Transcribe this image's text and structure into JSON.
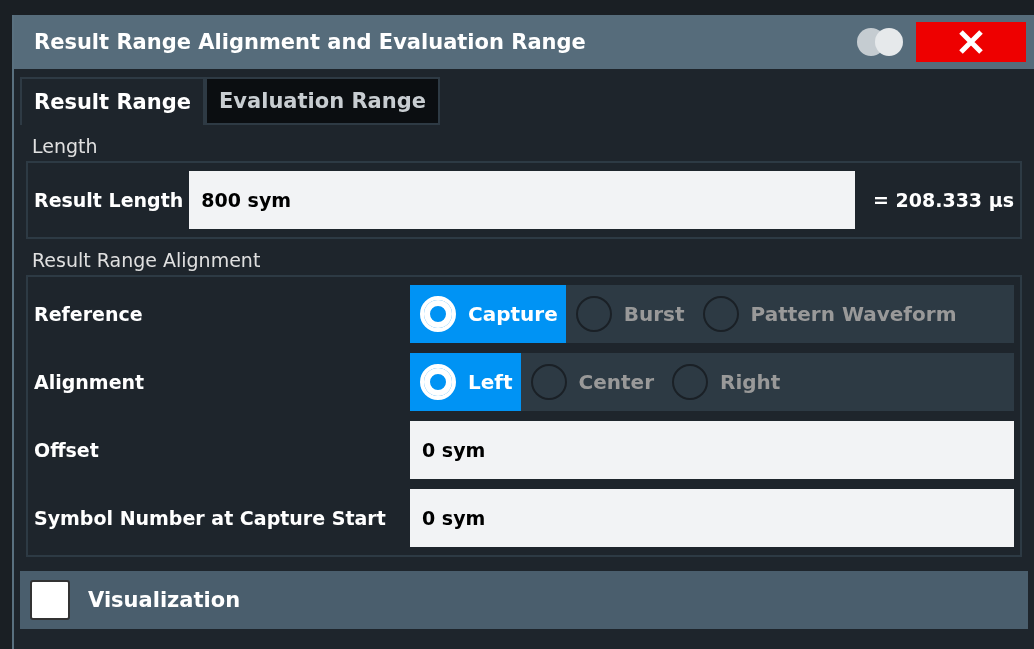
{
  "dialog": {
    "title": "Result Range Alignment and Evaluation Range"
  },
  "tabs": [
    {
      "label": "Result Range",
      "selected": true
    },
    {
      "label": "Evaluation Range",
      "selected": false
    }
  ],
  "length_section": {
    "heading": "Length",
    "result_length": {
      "label": "Result Length",
      "value": "800 sym",
      "equivalent": "= 208.333 µs"
    }
  },
  "alignment_section": {
    "heading": "Result Range Alignment",
    "reference": {
      "label": "Reference",
      "options": [
        {
          "label": "Capture",
          "selected": true
        },
        {
          "label": "Burst",
          "selected": false
        },
        {
          "label": "Pattern Waveform",
          "selected": false
        }
      ]
    },
    "alignment": {
      "label": "Alignment",
      "options": [
        {
          "label": "Left",
          "selected": true
        },
        {
          "label": "Center",
          "selected": false
        },
        {
          "label": "Right",
          "selected": false
        }
      ]
    },
    "offset": {
      "label": "Offset",
      "value": "0 sym"
    },
    "symbol_number": {
      "label": "Symbol Number at Capture Start",
      "value": "0 sym"
    }
  },
  "visualization": {
    "label": "Visualization",
    "checked": false
  }
}
